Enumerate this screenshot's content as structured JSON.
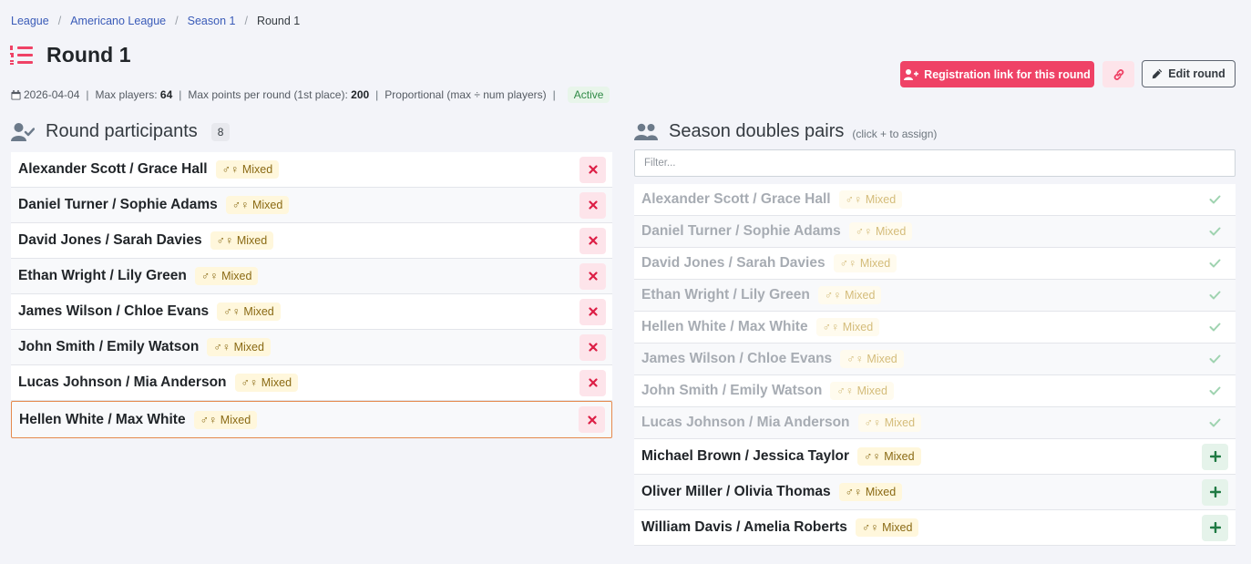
{
  "breadcrumb": [
    "League",
    "Americano League",
    "Season 1",
    "Round 1"
  ],
  "page_title": "Round 1",
  "meta": {
    "date": "2026-04-04",
    "max_players_label": "Max players:",
    "max_players": "64",
    "max_points_label": "Max points per round (1st place):",
    "max_points": "200",
    "scoring": "Proportional (max ÷ num players)",
    "status": "Active"
  },
  "actions": {
    "registration_link": "Registration link for this round",
    "edit_round": "Edit round"
  },
  "participants": {
    "title": "Round participants",
    "count": "8",
    "items": [
      {
        "name": "Alexander Scott / Grace Hall",
        "type": "♂♀ Mixed"
      },
      {
        "name": "Daniel Turner / Sophie Adams",
        "type": "♂♀ Mixed"
      },
      {
        "name": "David Jones / Sarah Davies",
        "type": "♂♀ Mixed"
      },
      {
        "name": "Ethan Wright / Lily Green",
        "type": "♂♀ Mixed"
      },
      {
        "name": "James Wilson / Chloe Evans",
        "type": "♂♀ Mixed"
      },
      {
        "name": "John Smith / Emily Watson",
        "type": "♂♀ Mixed"
      },
      {
        "name": "Lucas Johnson / Mia Anderson",
        "type": "♂♀ Mixed"
      },
      {
        "name": "Hellen White / Max White",
        "type": "♂♀ Mixed"
      }
    ]
  },
  "season_pairs": {
    "title": "Season doubles pairs",
    "hint": "(click + to assign)",
    "filter_placeholder": "Filter...",
    "items": [
      {
        "name": "Alexander Scott / Grace Hall",
        "type": "♂♀ Mixed",
        "assigned": true
      },
      {
        "name": "Daniel Turner / Sophie Adams",
        "type": "♂♀ Mixed",
        "assigned": true
      },
      {
        "name": "David Jones / Sarah Davies",
        "type": "♂♀ Mixed",
        "assigned": true
      },
      {
        "name": "Ethan Wright / Lily Green",
        "type": "♂♀ Mixed",
        "assigned": true
      },
      {
        "name": "Hellen White / Max White",
        "type": "♂♀ Mixed",
        "assigned": true
      },
      {
        "name": "James Wilson / Chloe Evans",
        "type": "♂♀ Mixed",
        "assigned": true
      },
      {
        "name": "John Smith / Emily Watson",
        "type": "♂♀ Mixed",
        "assigned": true
      },
      {
        "name": "Lucas Johnson / Mia Anderson",
        "type": "♂♀ Mixed",
        "assigned": true
      },
      {
        "name": "Michael Brown / Jessica Taylor",
        "type": "♂♀ Mixed",
        "assigned": false
      },
      {
        "name": "Oliver Miller / Olivia Thomas",
        "type": "♂♀ Mixed",
        "assigned": false
      },
      {
        "name": "William Davis / Amelia Roberts",
        "type": "♂♀ Mixed",
        "assigned": false
      }
    ]
  },
  "colors": {
    "accent": "#ef4266",
    "success": "#2f8a46",
    "link": "#3a5bb8",
    "highlight_border": "#e5894c"
  },
  "icons": {
    "title": "list-ol-icon",
    "date": "calendar-icon",
    "participants": "user-check-icon",
    "pairs": "users-icon",
    "registration": "user-plus-icon",
    "copy_link": "link-icon",
    "edit": "pencil-icon",
    "remove": "close-icon",
    "assigned": "check-icon",
    "add": "plus-icon"
  }
}
